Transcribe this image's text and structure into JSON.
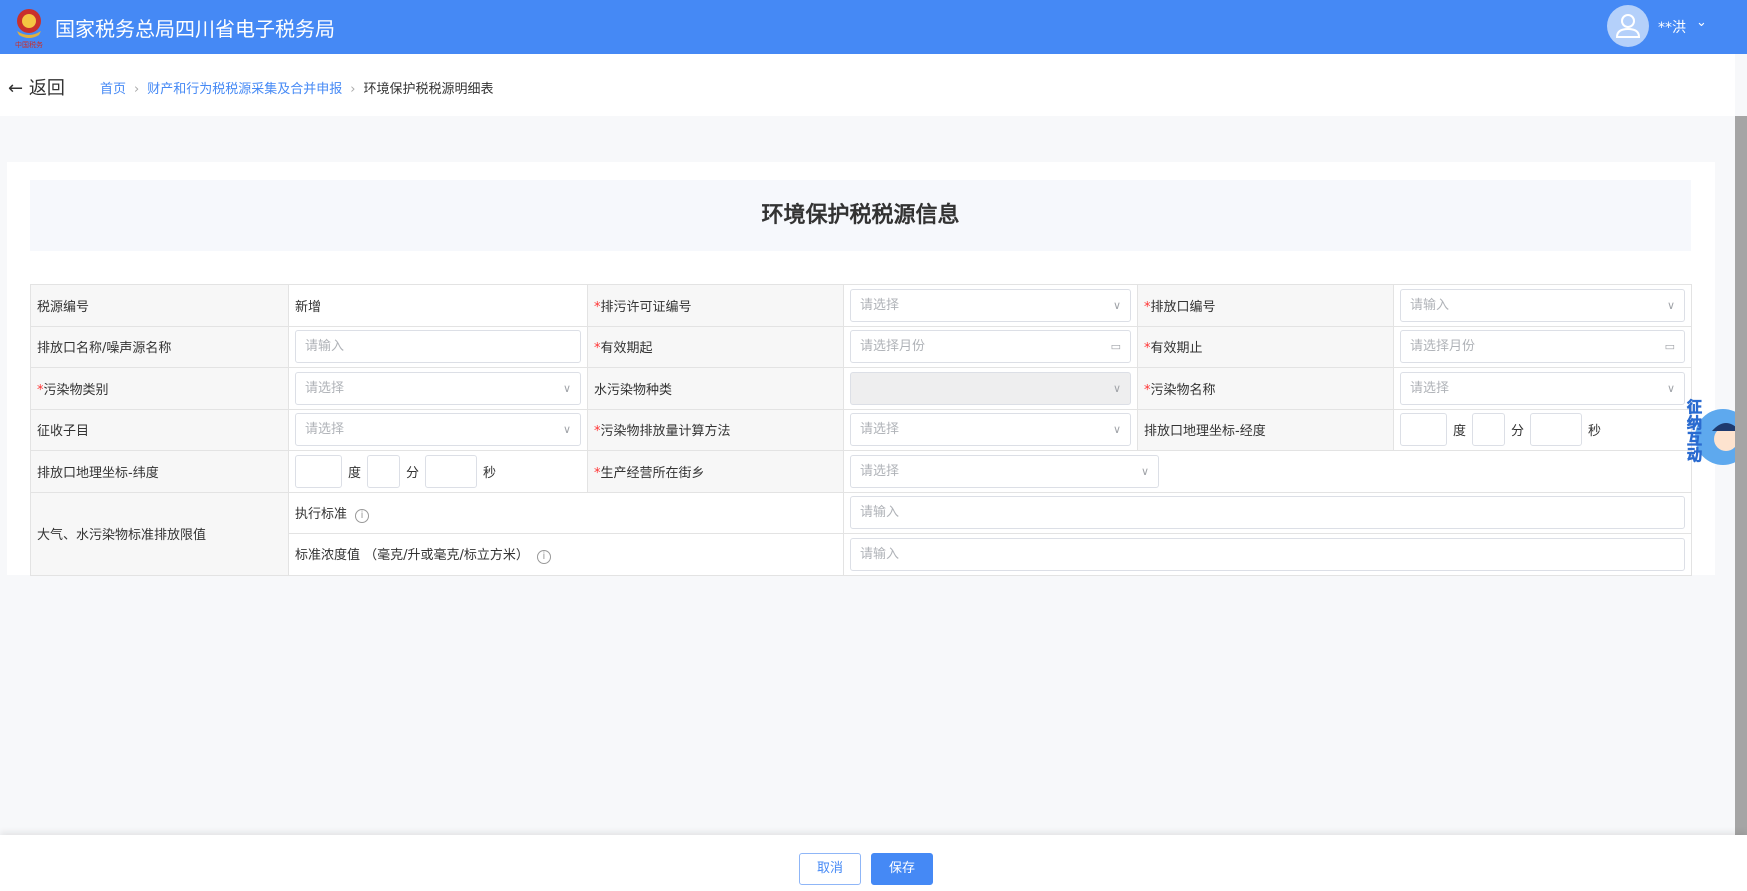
{
  "header": {
    "title": "国家税务总局四川省电子税务局",
    "user": "**洪",
    "logo_text": "中国税务"
  },
  "nav": {
    "back": "返回",
    "breadcrumb": [
      "首页",
      "财产和行为税税源采集及合并申报",
      "环境保护税税源明细表"
    ]
  },
  "form": {
    "title": "环境保护税税源信息",
    "r1": {
      "l1": "税源编号",
      "v1": "新增",
      "l2": "排污许可证编号",
      "p2": "请选择",
      "l3": "排放口编号",
      "p3": "请输入"
    },
    "r2": {
      "l1": "排放口名称/噪声源名称",
      "p1": "请输入",
      "l2": "有效期起",
      "p2": "请选择月份",
      "l3": "有效期止",
      "p3": "请选择月份"
    },
    "r3": {
      "l1": "污染物类别",
      "p1": "请选择",
      "l2": "水污染物种类",
      "l3": "污染物名称",
      "p3": "请选择"
    },
    "r4": {
      "l1": "征收子目",
      "p1": "请选择",
      "l2": "污染物排放量计算方法",
      "p2": "请选择",
      "l3": "排放口地理坐标-经度"
    },
    "r5": {
      "l1": "排放口地理坐标-纬度",
      "l2": "生产经营所在街乡",
      "p2": "请选择"
    },
    "r6": {
      "l1": "大气、水污染物标准排放限值",
      "s1": "执行标准",
      "s2": "标准浓度值 （毫克/升或毫克/标立方米）",
      "p": "请输入"
    },
    "units": {
      "deg": "度",
      "min": "分",
      "sec": "秒"
    }
  },
  "mascot": {
    "text": "征纳互动"
  },
  "footer": {
    "cancel": "取消",
    "save": "保存"
  },
  "colors": {
    "primary": "#4589f5",
    "required": "#ff3333"
  }
}
